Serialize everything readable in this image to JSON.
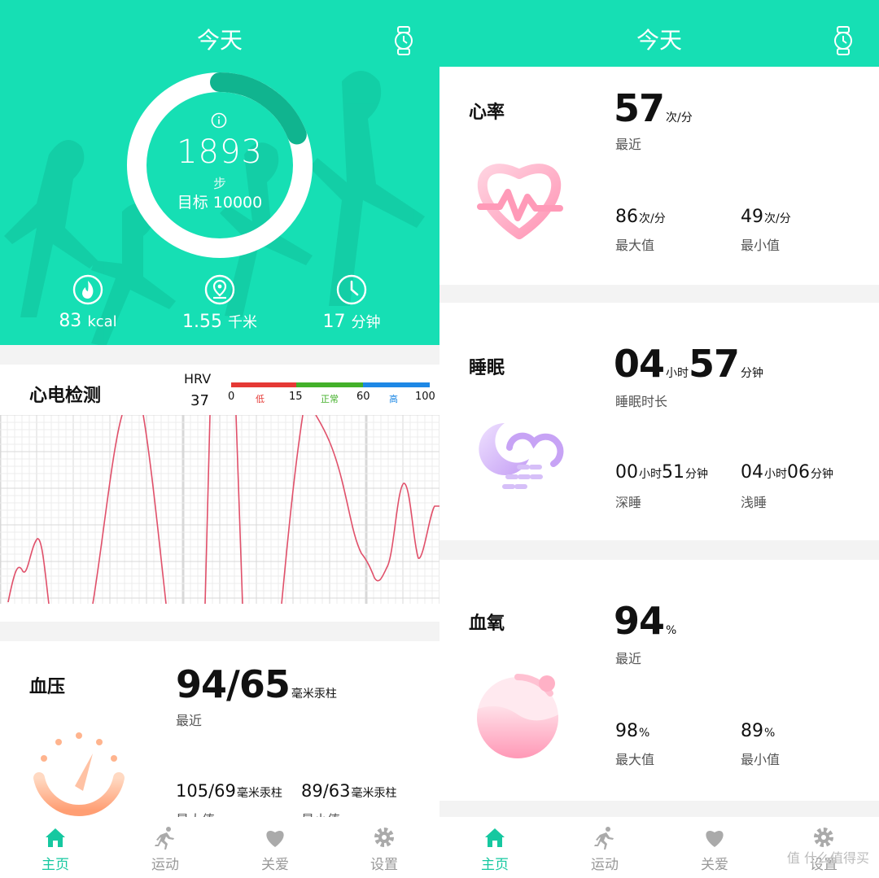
{
  "left": {
    "header": {
      "title": "今天"
    },
    "activity": {
      "steps": "1893",
      "steps_unit": "步",
      "goal": "目标 10000",
      "progress": 0.19,
      "stats": [
        {
          "icon": "flame-icon",
          "value": "83",
          "unit": "kcal"
        },
        {
          "icon": "location-pin-icon",
          "value": "1.55",
          "unit": "千米"
        },
        {
          "icon": "clock-icon",
          "value": "17",
          "unit": "分钟"
        }
      ]
    },
    "ecg": {
      "title": "心电检测",
      "hrv_label": "HRV",
      "hrv_value": "37",
      "scale": [
        {
          "label": "0"
        },
        {
          "label": "低",
          "color": "#e53935"
        },
        {
          "label": "15"
        },
        {
          "label": "正常",
          "color": "#43b02a"
        },
        {
          "label": "60"
        },
        {
          "label": "高",
          "color": "#1e88e5"
        },
        {
          "label": "100"
        }
      ],
      "line_color": "#e0506a"
    },
    "blood_pressure": {
      "title": "血压",
      "value": "94/65",
      "unit": "毫米汞柱",
      "latest_label": "最近",
      "max_value": "105/69",
      "max_unit": "毫米汞柱",
      "min_value": "89/63",
      "min_unit": "毫米汞柱",
      "max_label": "最大值",
      "min_label": "最小值"
    },
    "tabs": [
      {
        "icon": "home-icon",
        "label": "主页",
        "active": true
      },
      {
        "icon": "running-icon",
        "label": "运动",
        "active": false
      },
      {
        "icon": "heart-icon",
        "label": "关爱",
        "active": false
      },
      {
        "icon": "gear-icon",
        "label": "设置",
        "active": false
      }
    ]
  },
  "right": {
    "header": {
      "title": "今天"
    },
    "heart_rate": {
      "title": "心率",
      "value": "57",
      "unit": "次/分",
      "latest_label": "最近",
      "max_value": "86",
      "max_unit": "次/分",
      "max_label": "最大值",
      "min_value": "49",
      "min_unit": "次/分",
      "min_label": "最小值"
    },
    "sleep": {
      "title": "睡眠",
      "hours": "04",
      "hours_unit": "小时",
      "minutes": "57",
      "minutes_unit": "分钟",
      "duration_label": "睡眠时长",
      "deep_h": "00",
      "deep_m": "51",
      "deep_label": "深睡",
      "light_h": "04",
      "light_m": "06",
      "light_label": "浅睡",
      "h_unit": "小时",
      "m_unit": "分钟"
    },
    "spo2": {
      "title": "血氧",
      "value": "94",
      "unit": "%",
      "latest_label": "最近",
      "max_value": "98",
      "max_unit": "%",
      "max_label": "最大值",
      "min_value": "89",
      "min_unit": "%",
      "min_label": "最小值"
    },
    "tabs": [
      {
        "icon": "home-icon",
        "label": "主页",
        "active": true
      },
      {
        "icon": "running-icon",
        "label": "运动",
        "active": false
      },
      {
        "icon": "heart-icon",
        "label": "关爱",
        "active": false
      },
      {
        "icon": "gear-icon",
        "label": "设置",
        "active": false
      }
    ],
    "watermark": "值 什么值得买"
  }
}
